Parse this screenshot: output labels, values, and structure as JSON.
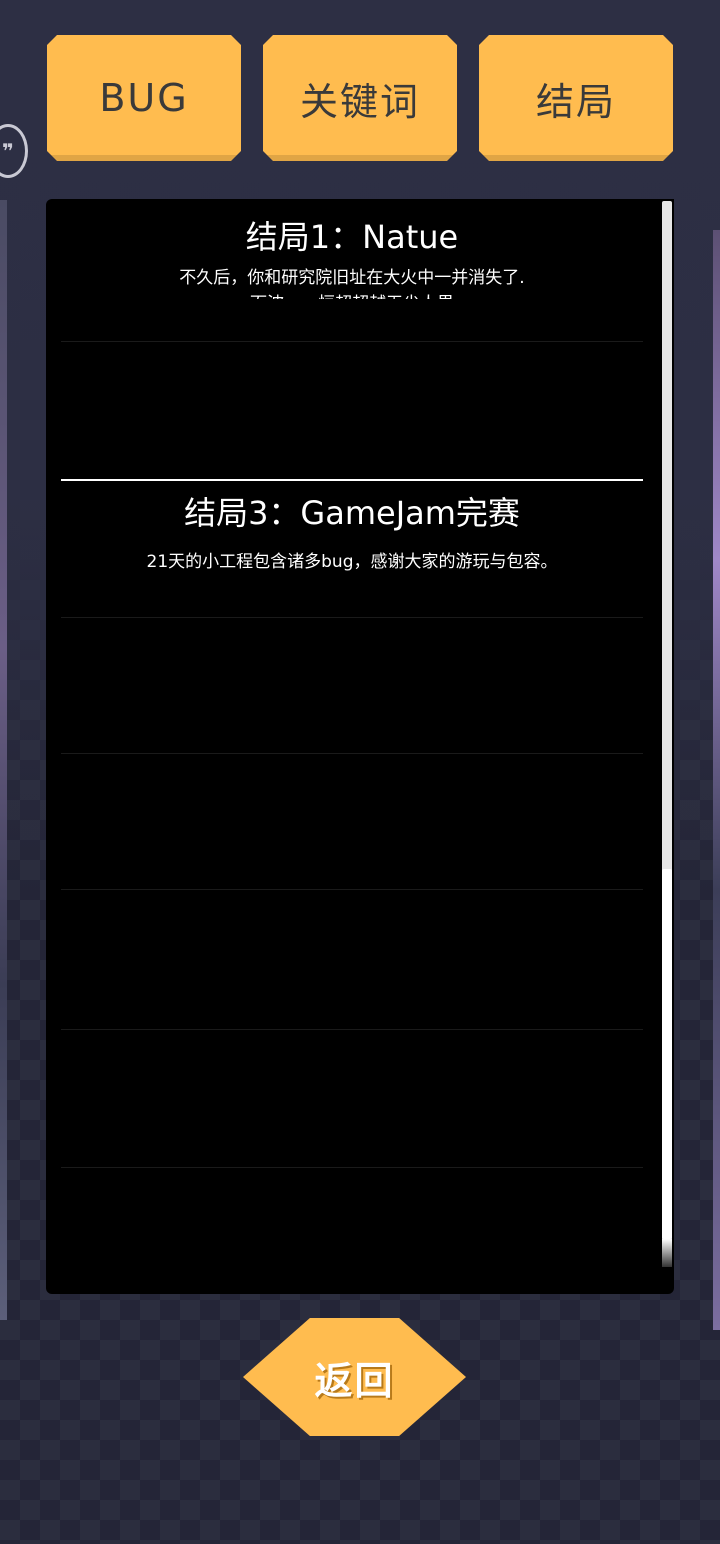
{
  "tabs": {
    "bug": "BUG",
    "keywords": "关键词",
    "endings": "结局"
  },
  "endings": [
    {
      "title": "结局1：Natue",
      "desc_line1": "不久后，你和研究院旧址在大火中一并消失了.",
      "desc_line2": "而波……恒超超越无尖人界"
    },
    {
      "title": "结局3：GameJam完赛",
      "desc_line1": "21天的小工程包含诸多bug，感谢大家的游玩与包容。"
    }
  ],
  "back_button": "返回",
  "colors": {
    "accent": "#ffbc4f",
    "panel": "#000000",
    "background": "#2b2c3c"
  }
}
